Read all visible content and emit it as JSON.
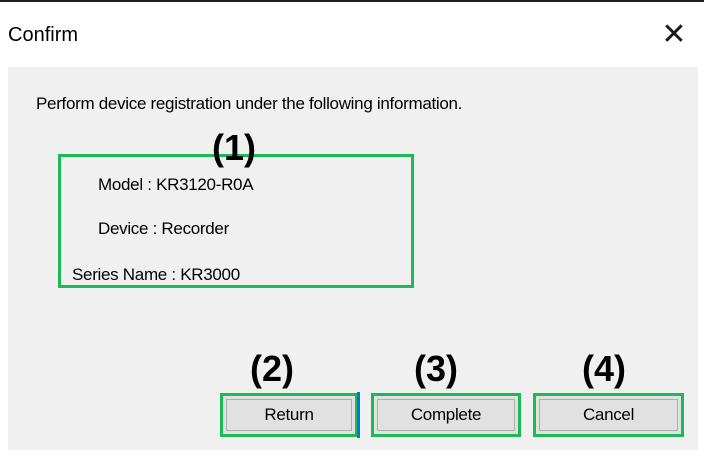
{
  "window": {
    "title": "Confirm",
    "close_glyph": "✕"
  },
  "message": "Perform device registration under the following information.",
  "info": {
    "model": "Model : KR3120-R0A",
    "device": "Device : Recorder",
    "series": "Series Name : KR3000"
  },
  "markers": {
    "m1": "(1)",
    "m2": "(2)",
    "m3": "(3)",
    "m4": "(4)"
  },
  "buttons": {
    "return_label": "Return",
    "complete_label": "Complete",
    "cancel_label": "Cancel"
  },
  "colors": {
    "highlight": "#1db954",
    "client_bg": "#f0f0f0",
    "focus": "#0078d7"
  }
}
